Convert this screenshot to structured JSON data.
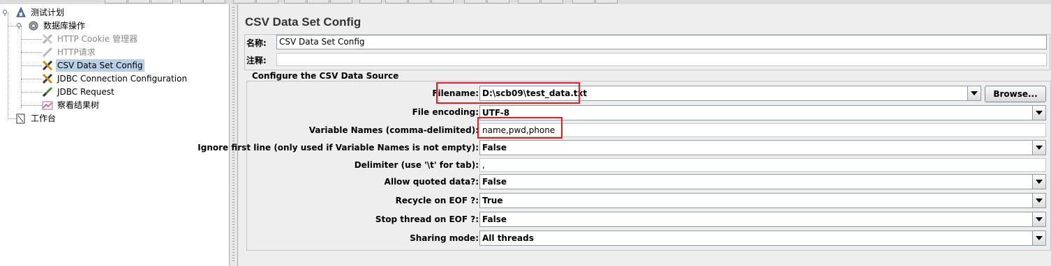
{
  "tree": {
    "items": [
      {
        "label": "测试计划",
        "icon": "test-plan-icon"
      },
      {
        "label": "数据库操作",
        "icon": "thread-group-gear-icon"
      },
      {
        "label": "HTTP Cookie 管理器",
        "icon": "wrench-icon"
      },
      {
        "label": "HTTP请求",
        "icon": "pipette-icon"
      },
      {
        "label": "CSV Data Set Config",
        "icon": "wrench-icon"
      },
      {
        "label": "JDBC Connection Configuration",
        "icon": "wrench-icon"
      },
      {
        "label": "JDBC Request",
        "icon": "pipette-icon"
      },
      {
        "label": "察看结果树",
        "icon": "graph-icon"
      },
      {
        "label": "工作台",
        "icon": "workbench-icon"
      }
    ]
  },
  "panel": {
    "title": "CSV Data Set Config",
    "name_label": "名称:",
    "name_value": "CSV Data Set Config",
    "comment_label": "注释:",
    "comment_value": ""
  },
  "csv": {
    "legend": "Configure the CSV Data Source",
    "filename_label": "Filename:",
    "filename_value": "D:\\scb09\\test_data.txt",
    "browse_label": "Browse...",
    "encoding_label": "File encoding:",
    "encoding_value": "UTF-8",
    "varnames_label": "Variable Names (comma-delimited):",
    "varnames_value": "name,pwd,phone",
    "ignore_label": "Ignore first line (only used if Variable Names is not empty):",
    "ignore_value": "False",
    "delimiter_label": "Delimiter (use '\\t' for tab):",
    "delimiter_value": ",",
    "quoted_label": "Allow quoted data?:",
    "quoted_value": "False",
    "recycle_label": "Recycle on EOF ?:",
    "recycle_value": "True",
    "stop_label": "Stop thread on EOF ?:",
    "stop_value": "False",
    "sharing_label": "Sharing mode:",
    "sharing_value": "All threads"
  },
  "colors": {
    "highlight": "#e02020",
    "selection": "#b8cfe5"
  }
}
